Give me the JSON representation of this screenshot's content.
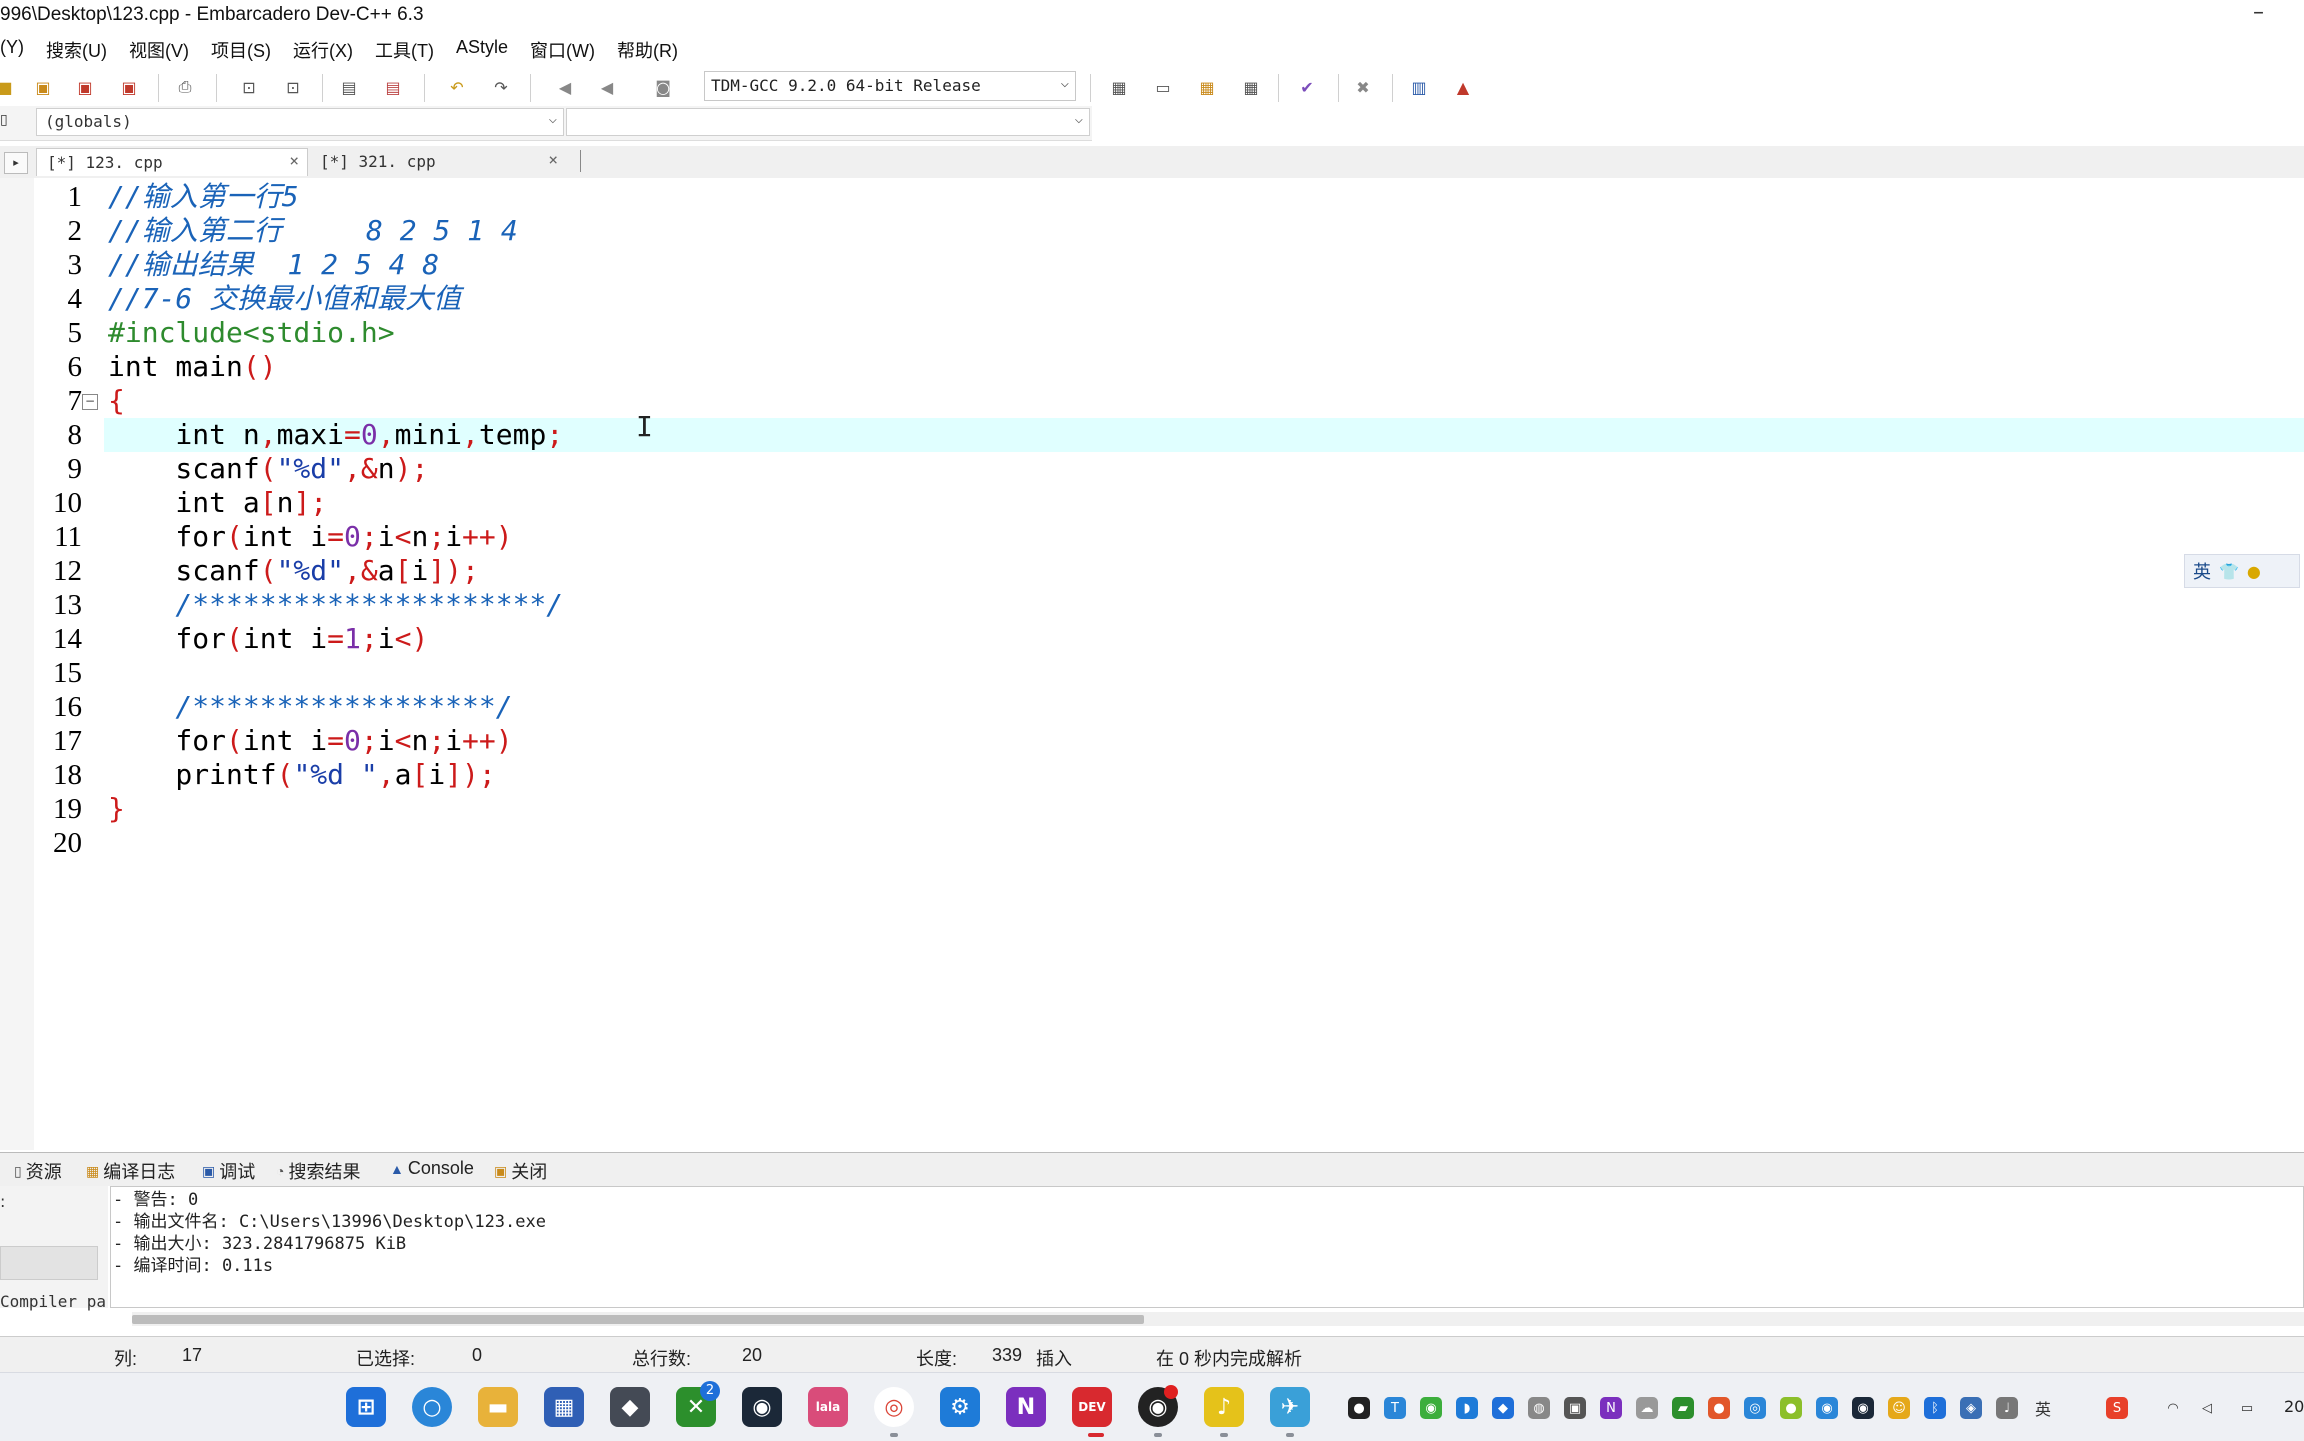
{
  "window": {
    "title": "996\\Desktop\\123.cpp - Embarcadero Dev-C++ 6.3",
    "minimize_glyph": "–"
  },
  "menu": [
    "(Y)",
    "搜索(U)",
    "视图(V)",
    "项目(S)",
    "运行(X)",
    "工具(T)",
    "AStyle",
    "窗口(W)",
    "帮助(R)"
  ],
  "toolbar": {
    "compiler": "TDM-GCC 9.2.0 64-bit Release"
  },
  "scope": {
    "left": "(globals)",
    "right": ""
  },
  "tabs": [
    {
      "label": "[*] 123. cpp",
      "close": "×"
    },
    {
      "label": "[*] 321. cpp",
      "close": "×"
    }
  ],
  "editor": {
    "current_line": 8,
    "lines": [
      "//输入第一行5",
      "//输入第二行     8 2 5 1 4",
      "//输出结果  1 2 5 4 8",
      "//7-6 交换最小值和最大值",
      "#include<stdio.h>",
      "int main()",
      "{",
      "    int n,maxi=0,mini,temp;",
      "    scanf(\"%d\",&n);",
      "    int a[n];",
      "    for(int i=0;i<n;i++)",
      "    scanf(\"%d\",&a[i]);",
      "    /*********************/",
      "    for(int i=1;i<)",
      "",
      "    /******************/",
      "    for(int i=0;i<n;i++)",
      "    printf(\"%d \",a[i]);",
      "}",
      ""
    ]
  },
  "ime": {
    "lang": "英"
  },
  "bottom_tabs": [
    "资源",
    "编译日志",
    "调试",
    "搜索结果",
    "Console",
    "关闭"
  ],
  "log": {
    "side_label": "Compiler pa",
    "lines": [
      "- 警告: 0",
      "- 输出文件名: C:\\Users\\13996\\Desktop\\123.exe",
      "- 输出大小: 323.2841796875 KiB",
      "- 编译时间: 0.11s"
    ]
  },
  "status": {
    "col_label": "列:",
    "col_value": "17",
    "sel_label": "已选择:",
    "sel_value": "0",
    "lines_label": "总行数:",
    "lines_value": "20",
    "len_label": "长度:",
    "len_value": "339",
    "mode": "插入",
    "parse": "在 0 秒内完成解析"
  },
  "taskbar": {
    "badge_count": "2",
    "clock_partial": "20"
  },
  "colors": {
    "comment": "#1a63b8",
    "keyword_paren": "#cc1a1a",
    "string": "#1a3ea8",
    "preproc": "#2e8b2e",
    "current_line_bg": "#e0ffff"
  }
}
